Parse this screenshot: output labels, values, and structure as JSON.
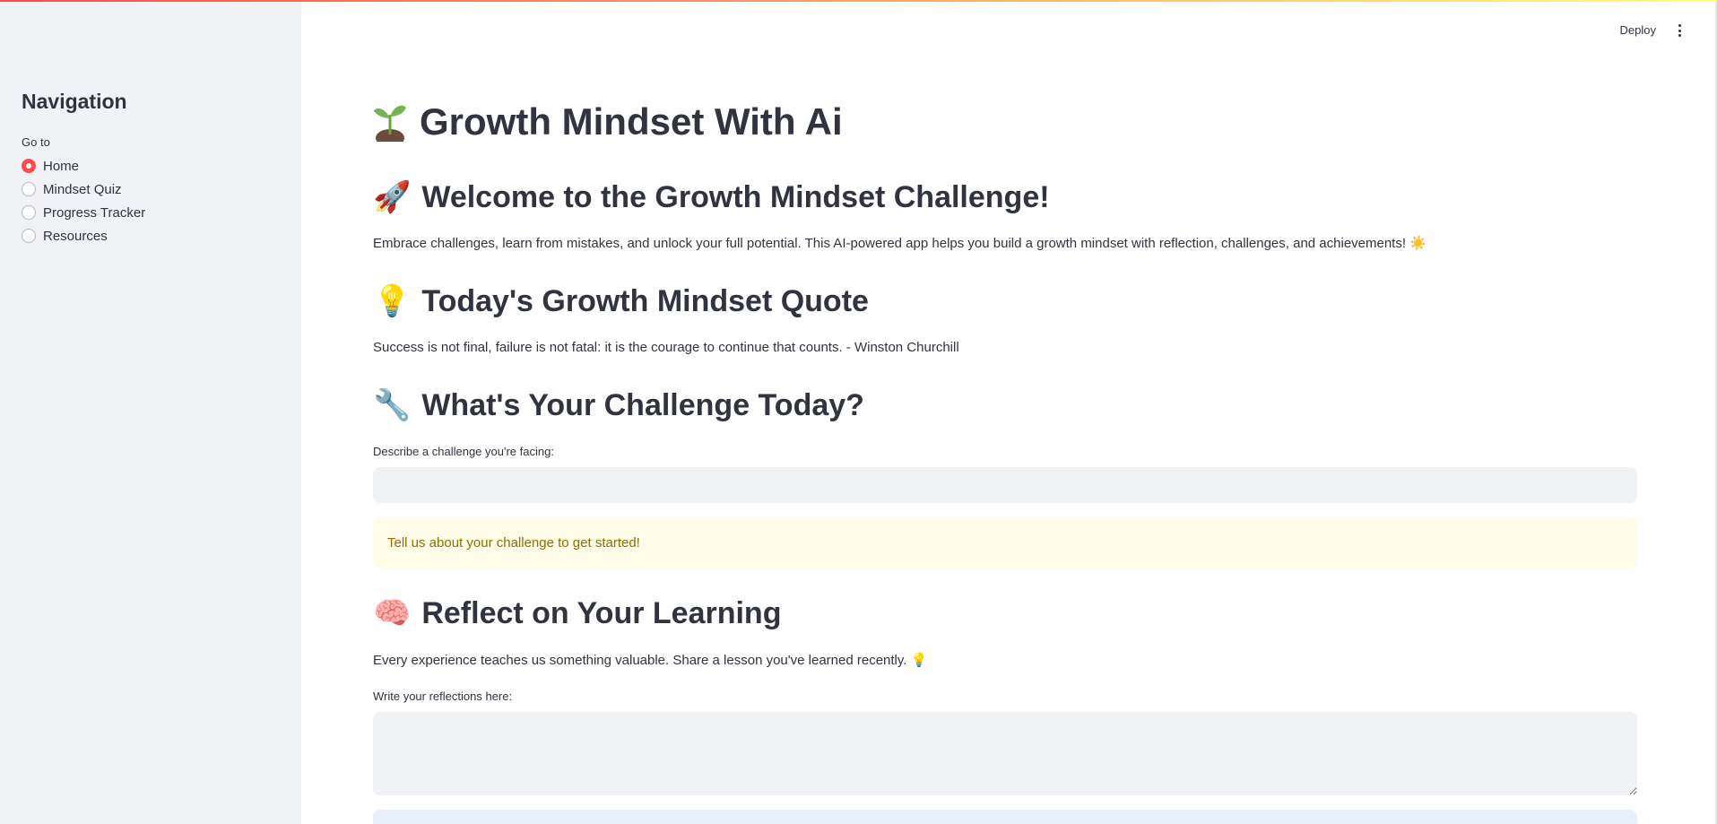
{
  "header": {
    "deploy_label": "Deploy"
  },
  "sidebar": {
    "title": "Navigation",
    "radio_group_label": "Go to",
    "options": [
      {
        "label": "Home",
        "selected": true
      },
      {
        "label": "Mindset Quiz",
        "selected": false
      },
      {
        "label": "Progress Tracker",
        "selected": false
      },
      {
        "label": "Resources",
        "selected": false
      }
    ]
  },
  "main": {
    "title": "Growth Mindset With Ai",
    "title_icon": "seedling-icon",
    "welcome": {
      "icon": "🚀",
      "heading": "Welcome to the Growth Mindset Challenge!",
      "text": "Embrace challenges, learn from mistakes, and unlock your full potential. This AI-powered app helps you build a growth mindset with reflection, challenges, and achievements! ☀️"
    },
    "quote": {
      "icon": "💡",
      "heading": "Today's Growth Mindset Quote",
      "text": "Success is not final, failure is not fatal: it is the courage to continue that counts. - Winston Churchill"
    },
    "challenge": {
      "icon": "🔧",
      "heading": "What's Your Challenge Today?",
      "input_label": "Describe a challenge you're facing:",
      "input_value": "",
      "warning": "Tell us about your challenge to get started!"
    },
    "reflect": {
      "icon": "🧠",
      "heading": "Reflect on Your Learning",
      "text": "Every experience teaches us something valuable. Share a lesson you've learned recently. 💡",
      "textarea_label": "Write your reflections here:",
      "textarea_value": ""
    }
  },
  "colors": {
    "accent": "#ff4b4b",
    "sidebar_bg": "#f0f2f6",
    "text": "#31333f",
    "warning_bg": "#fffce7",
    "warning_text": "#926c05",
    "info_bg": "#e8f1fb"
  }
}
